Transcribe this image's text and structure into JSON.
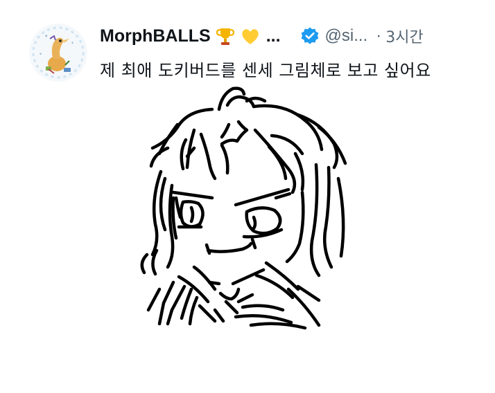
{
  "tweet": {
    "author": {
      "display_name": "MorphBALLS",
      "name_emojis": [
        "trophy-emoji",
        "yellow-heart-emoji"
      ],
      "truncation": "...",
      "handle": "@si...",
      "verified_icon": "verified-badge-icon"
    },
    "separator": "·",
    "time": "3시간",
    "text": "제 최애 도키버드를 센세 그림체로 보고 싶어요",
    "media": {
      "type": "drawing",
      "description_icon": "line-art-character-drawing"
    }
  },
  "colors": {
    "text_primary": "#0f1419",
    "text_secondary": "#536471",
    "verified_blue": "#1d9bf0",
    "trophy_gold": "#f5b400",
    "heart_yellow": "#ffcc33"
  }
}
